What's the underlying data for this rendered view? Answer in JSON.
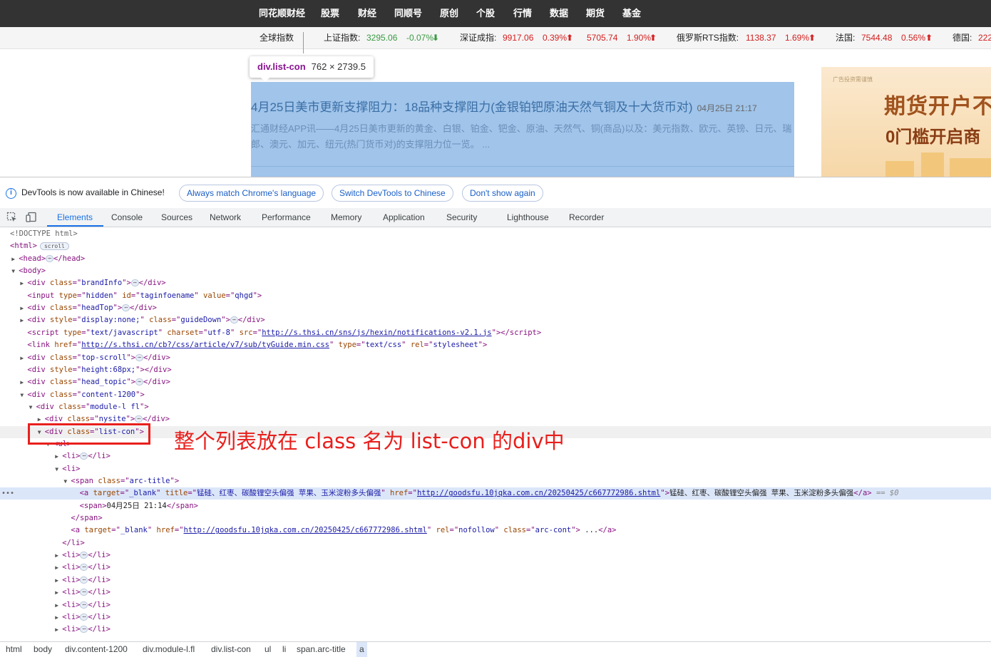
{
  "site": {
    "nav_items": [
      "同花顺财经",
      "股票",
      "财经",
      "同顺号",
      "原创",
      "个股",
      "行情",
      "数据",
      "期货",
      "基金"
    ],
    "ticker": {
      "global_label": "全球指数",
      "items": [
        {
          "name": "上证指数:",
          "value": "3295.06",
          "change": "-0.07%",
          "direction": "down"
        },
        {
          "name": "深证成指:",
          "value": "9917.06",
          "change": "0.39%",
          "direction": "up"
        },
        {
          "name": "",
          "value": "5705.74",
          "change": "1.90%",
          "direction": "up"
        },
        {
          "name": "俄罗斯RTS指数:",
          "value": "1138.37",
          "change": "1.69%",
          "direction": "up"
        },
        {
          "name": "法国:",
          "value": "7544.48",
          "change": "0.56%",
          "direction": "up"
        },
        {
          "name": "德国:",
          "value": "222",
          "change": "",
          "direction": "up"
        }
      ]
    },
    "tooltip": {
      "selector": "div.list-con",
      "dimensions": "762 × 2739.5"
    },
    "article": {
      "title": "4月25日美市更新支撑阻力：18品种支撑阻力(金银铂钯原油天然气铜及十大货币对)",
      "time": "04月25日 21:17",
      "summary": "汇通财经APP讯——4月25日美市更新的黄金、白银、铂金、钯金、原油、天然气、铜(商品)以及：美元指数、欧元、英镑、日元、瑞郎、澳元、加元、纽元(热门货币对)的支撑阻力位一览。 ..."
    },
    "ad": {
      "small_text": "广告投资需谨慎",
      "line1": "期货开户不",
      "line2": "0门槛开启商"
    }
  },
  "devtools": {
    "infobar": {
      "message": "DevTools is now available in Chinese!",
      "buttons": [
        "Always match Chrome's language",
        "Switch DevTools to Chinese",
        "Don't show again"
      ]
    },
    "tabs": [
      "Elements",
      "Console",
      "Sources",
      "Network",
      "Performance",
      "Memory",
      "Application",
      "Security",
      "Lighthouse",
      "Recorder"
    ],
    "active_tab": "Elements",
    "dom_lines": [
      {
        "depth": 0,
        "tri": "",
        "html": "<span class=\"cm\">&lt;!DOCTYPE html&gt;</span>"
      },
      {
        "depth": 0,
        "tri": "",
        "html": "<span class=\"tg\">&lt;html&gt;</span><span class=\"badge\">scroll</span>"
      },
      {
        "depth": 1,
        "tri": "▶",
        "html": "<span class=\"tg\">&lt;head&gt;</span><span class=\"ell\">⋯</span><span class=\"tg\">&lt;/head&gt;</span>"
      },
      {
        "depth": 1,
        "tri": "▼",
        "html": "<span class=\"tg\">&lt;body&gt;</span>"
      },
      {
        "depth": 2,
        "tri": "▶",
        "html": "<span class=\"tg\">&lt;div </span><span class=\"at\">class</span><span class=\"tg\">=\"</span><span class=\"av\">brandInfo</span><span class=\"tg\">\"&gt;</span><span class=\"ell\">⋯</span><span class=\"tg\">&lt;/div&gt;</span>"
      },
      {
        "depth": 2,
        "tri": "",
        "html": "<span class=\"tg\">&lt;input </span><span class=\"at\">type</span><span class=\"tg\">=\"</span><span class=\"av\">hidden</span><span class=\"tg\">\" </span><span class=\"at\">id</span><span class=\"tg\">=\"</span><span class=\"av\">taginfoename</span><span class=\"tg\">\" </span><span class=\"at\">value</span><span class=\"tg\">=\"</span><span class=\"av\">qhgd</span><span class=\"tg\">\"&gt;</span>"
      },
      {
        "depth": 2,
        "tri": "▶",
        "html": "<span class=\"tg\">&lt;div </span><span class=\"at\">class</span><span class=\"tg\">=\"</span><span class=\"av\">headTop</span><span class=\"tg\">\"&gt;</span><span class=\"ell\">⋯</span><span class=\"tg\">&lt;/div&gt;</span>"
      },
      {
        "depth": 2,
        "tri": "▶",
        "html": "<span class=\"tg\">&lt;div </span><span class=\"at\">style</span><span class=\"tg\">=\"</span><span class=\"av\">display:none;</span><span class=\"tg\">\" </span><span class=\"at\">class</span><span class=\"tg\">=\"</span><span class=\"av\">guideDown</span><span class=\"tg\">\"&gt;</span><span class=\"ell\">⋯</span><span class=\"tg\">&lt;/div&gt;</span>"
      },
      {
        "depth": 2,
        "tri": "",
        "html": "<span class=\"tg\">&lt;script </span><span class=\"at\">type</span><span class=\"tg\">=\"</span><span class=\"av\">text/javascript</span><span class=\"tg\">\" </span><span class=\"at\">charset</span><span class=\"tg\">=\"</span><span class=\"av\">utf-8</span><span class=\"tg\">\" </span><span class=\"at\">src</span><span class=\"tg\">=\"</span><span class=\"lk\">http://s.thsi.cn/sns/js/hexin/notifications-v2.1.js</span><span class=\"tg\">\"&gt;&lt;/script&gt;</span>"
      },
      {
        "depth": 2,
        "tri": "",
        "html": "<span class=\"tg\">&lt;link </span><span class=\"at\">href</span><span class=\"tg\">=\"</span><span class=\"lk\">http://s.thsi.cn/cb?/css/article/v7/sub/tyGuide.min.css</span><span class=\"tg\">\" </span><span class=\"at\">type</span><span class=\"tg\">=\"</span><span class=\"av\">text/css</span><span class=\"tg\">\" </span><span class=\"at\">rel</span><span class=\"tg\">=\"</span><span class=\"av\">stylesheet</span><span class=\"tg\">\"&gt;</span>"
      },
      {
        "depth": 2,
        "tri": "▶",
        "html": "<span class=\"tg\">&lt;div </span><span class=\"at\">class</span><span class=\"tg\">=\"</span><span class=\"av\">top-scroll</span><span class=\"tg\">\"&gt;</span><span class=\"ell\">⋯</span><span class=\"tg\">&lt;/div&gt;</span>"
      },
      {
        "depth": 2,
        "tri": "",
        "html": "<span class=\"tg\">&lt;div </span><span class=\"at\">style</span><span class=\"tg\">=\"</span><span class=\"av\">height:68px;</span><span class=\"tg\">\"&gt;&lt;/div&gt;</span>"
      },
      {
        "depth": 2,
        "tri": "▶",
        "html": "<span class=\"tg\">&lt;div </span><span class=\"at\">class</span><span class=\"tg\">=\"</span><span class=\"av\">head_topic</span><span class=\"tg\">\"&gt;</span><span class=\"ell\">⋯</span><span class=\"tg\">&lt;/div&gt;</span>"
      },
      {
        "depth": 2,
        "tri": "▼",
        "html": "<span class=\"tg\">&lt;div </span><span class=\"at\">class</span><span class=\"tg\">=\"</span><span class=\"av\">content-1200</span><span class=\"tg\">\"&gt;</span>"
      },
      {
        "depth": 3,
        "tri": "▼",
        "html": "<span class=\"tg\">&lt;div </span><span class=\"at\">class</span><span class=\"tg\">=\"</span><span class=\"av\">module-l fl</span><span class=\"tg\">\"&gt;</span>"
      },
      {
        "depth": 4,
        "tri": "▶",
        "html": "<span class=\"tg\">&lt;div </span><span class=\"at\">class</span><span class=\"tg\">=\"</span><span class=\"av\">nysite</span><span class=\"tg\">\"&gt;</span><span class=\"ell\">⋯</span><span class=\"tg\">&lt;/div&gt;</span>"
      },
      {
        "depth": 4,
        "tri": "▼",
        "hover": true,
        "html": "<span class=\"tg\">&lt;div </span><span class=\"at\">class</span><span class=\"tg\">=\"</span><span class=\"av\">list-con</span><span class=\"tg\">\"&gt;</span>"
      },
      {
        "depth": 5,
        "tri": "▼",
        "html": "<span class=\"tg\">&lt;ul&gt;</span>"
      },
      {
        "depth": 6,
        "tri": "▶",
        "html": "<span class=\"tg\">&lt;li&gt;</span><span class=\"ell\">⋯</span><span class=\"tg\">&lt;/li&gt;</span>"
      },
      {
        "depth": 6,
        "tri": "▼",
        "html": "<span class=\"tg\">&lt;li&gt;</span>"
      },
      {
        "depth": 7,
        "tri": "▼",
        "html": "<span class=\"tg\">&lt;span </span><span class=\"at\">class</span><span class=\"tg\">=\"</span><span class=\"av\">arc-title</span><span class=\"tg\">\"&gt;</span>"
      },
      {
        "depth": 8,
        "tri": "",
        "selected": true,
        "html": "<span class=\"tg\">&lt;a </span><span class=\"at\">target</span><span class=\"tg\">=\"</span><span class=\"av\">_blank</span><span class=\"tg\">\" </span><span class=\"at\">title</span><span class=\"tg\">=\"</span><span class=\"av\">锰硅、红枣、碳酸锂空头偏强 苹果、玉米淀粉多头偏强</span><span class=\"tg\">\" </span><span class=\"at\">href</span><span class=\"tg\">=\"</span><span class=\"lk\">http://goodsfu.10jqka.com.cn/20250425/c667772986.shtml</span><span class=\"tg\">\"&gt;</span><span class=\"tx\">锰硅、红枣、碳酸锂空头偏强 苹果、玉米淀粉多头偏强</span><span class=\"tg\">&lt;/a&gt;</span> <span class=\"eq\">== $0</span>"
      },
      {
        "depth": 8,
        "tri": "",
        "html": "<span class=\"tg\">&lt;span&gt;</span><span class=\"tx\">04月25日 21:14</span><span class=\"tg\">&lt;/span&gt;</span>"
      },
      {
        "depth": 7,
        "tri": "",
        "html": "<span class=\"tg\">&lt;/span&gt;</span>"
      },
      {
        "depth": 7,
        "tri": "",
        "html": "<span class=\"tg\">&lt;a </span><span class=\"at\">target</span><span class=\"tg\">=\"</span><span class=\"av\">_blank</span><span class=\"tg\">\" </span><span class=\"at\">href</span><span class=\"tg\">=\"</span><span class=\"lk\">http://goodsfu.10jqka.com.cn/20250425/c667772986.shtml</span><span class=\"tg\">\" </span><span class=\"at\">rel</span><span class=\"tg\">=\"</span><span class=\"av\">nofollow</span><span class=\"tg\">\" </span><span class=\"at\">class</span><span class=\"tg\">=\"</span><span class=\"av\">arc-cont</span><span class=\"tg\">\"&gt;</span><span class=\"tx\"> ...</span><span class=\"tg\">&lt;/a&gt;</span>"
      },
      {
        "depth": 6,
        "tri": "",
        "html": "<span class=\"tg\">&lt;/li&gt;</span>"
      },
      {
        "depth": 6,
        "tri": "▶",
        "html": "<span class=\"tg\">&lt;li&gt;</span><span class=\"ell\">⋯</span><span class=\"tg\">&lt;/li&gt;</span>"
      },
      {
        "depth": 6,
        "tri": "▶",
        "html": "<span class=\"tg\">&lt;li&gt;</span><span class=\"ell\">⋯</span><span class=\"tg\">&lt;/li&gt;</span>"
      },
      {
        "depth": 6,
        "tri": "▶",
        "html": "<span class=\"tg\">&lt;li&gt;</span><span class=\"ell\">⋯</span><span class=\"tg\">&lt;/li&gt;</span>"
      },
      {
        "depth": 6,
        "tri": "▶",
        "html": "<span class=\"tg\">&lt;li&gt;</span><span class=\"ell\">⋯</span><span class=\"tg\">&lt;/li&gt;</span>"
      },
      {
        "depth": 6,
        "tri": "▶",
        "html": "<span class=\"tg\">&lt;li&gt;</span><span class=\"ell\">⋯</span><span class=\"tg\">&lt;/li&gt;</span>"
      },
      {
        "depth": 6,
        "tri": "▶",
        "html": "<span class=\"tg\">&lt;li&gt;</span><span class=\"ell\">⋯</span><span class=\"tg\">&lt;/li&gt;</span>"
      },
      {
        "depth": 6,
        "tri": "▶",
        "html": "<span class=\"tg\">&lt;li&gt;</span><span class=\"ell\">⋯</span><span class=\"tg\">&lt;/li&gt;</span>"
      }
    ],
    "annotation": "整个列表放在 class 名为 list-con 的div中",
    "breadcrumbs": [
      "html",
      "body",
      "div.content-1200",
      "div.module-l.fl",
      "div.list-con",
      "ul",
      "li",
      "span.arc-title",
      "a"
    ]
  }
}
